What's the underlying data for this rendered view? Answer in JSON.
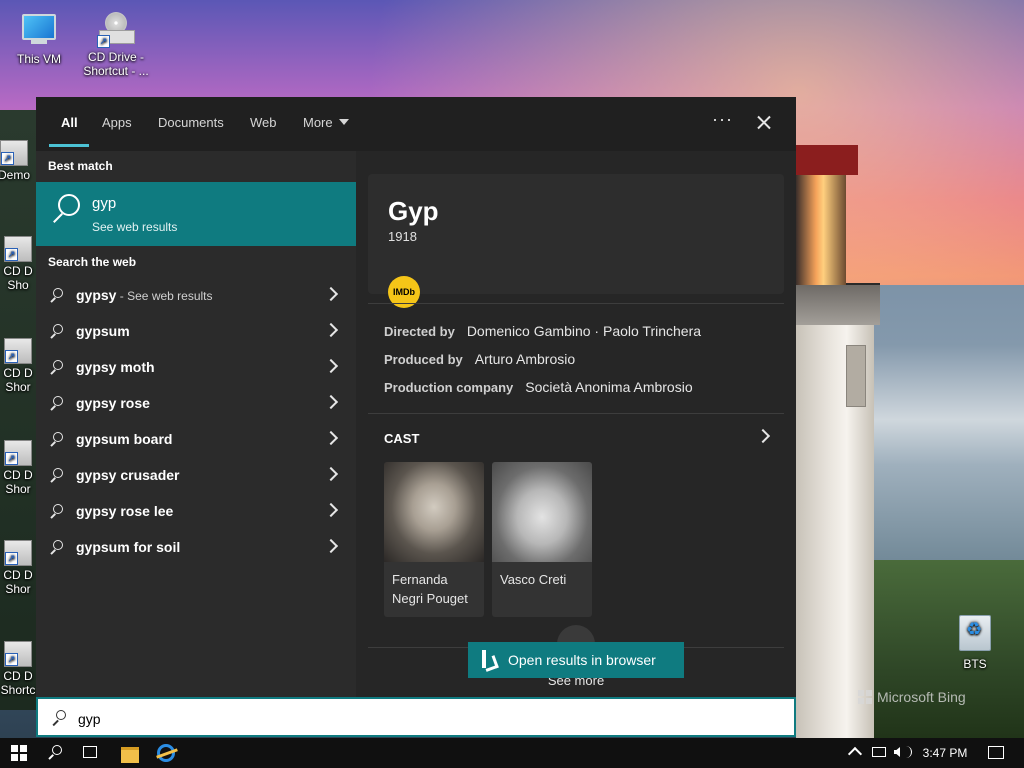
{
  "search_flyout": {
    "tabs": [
      {
        "label": "All",
        "active": true
      },
      {
        "label": "Apps"
      },
      {
        "label": "Documents"
      },
      {
        "label": "Web"
      },
      {
        "label": "More"
      }
    ]
  },
  "best_match": {
    "heading": "Best match",
    "query": "gyp",
    "subtitle": "See web results"
  },
  "search_the_web": {
    "heading": "Search the web",
    "items": [
      {
        "bold": "gypsy",
        "suffix": " - See web results"
      },
      {
        "bold": "gypsum",
        "suffix": ""
      },
      {
        "bold": "gypsy moth",
        "suffix": ""
      },
      {
        "bold": "gypsy rose",
        "suffix": ""
      },
      {
        "bold": "gypsum board",
        "suffix": ""
      },
      {
        "bold": "gypsy crusader",
        "suffix": ""
      },
      {
        "bold": "gypsy rose lee",
        "suffix": ""
      },
      {
        "bold": "gypsum for soil",
        "suffix": ""
      }
    ]
  },
  "detail": {
    "title": "Gyp",
    "year": "1918",
    "imdb_badge": "IMDb",
    "details": [
      {
        "label": "Directed by",
        "value": "Domenico Gambino · Paolo Trinchera"
      },
      {
        "label": "Produced by",
        "value": "Arturo Ambrosio"
      },
      {
        "label": "Production company",
        "value": "Società Anonima Ambrosio"
      }
    ],
    "cast_heading": "CAST",
    "cast": [
      {
        "name": "Fernanda Negri Pouget"
      },
      {
        "name": "Vasco Creti"
      }
    ],
    "see_more": "See more",
    "open_browser": "Open results in browser"
  },
  "search_box": {
    "value": "gyp",
    "icon": "search-icon"
  },
  "desktop": {
    "icons": [
      {
        "label": "This VM"
      },
      {
        "label": "CD Drive - Shortcut - ..."
      },
      {
        "label": "Demo"
      },
      {
        "label": "CD D Sho"
      },
      {
        "label": "CD D Shor"
      },
      {
        "label": "CD D Shor"
      },
      {
        "label": "CD D Shor"
      },
      {
        "label": "CD D Shortc"
      },
      {
        "label": "BTS"
      }
    ],
    "bing_watermark": "Microsoft Bing"
  },
  "taskbar": {
    "time": "3:47 PM"
  },
  "colors": {
    "accent": "#0f7b80",
    "tab_underline": "#4cc2d4",
    "panel_dark": "#1f1f1f",
    "imdb_yellow": "#f5c518"
  }
}
